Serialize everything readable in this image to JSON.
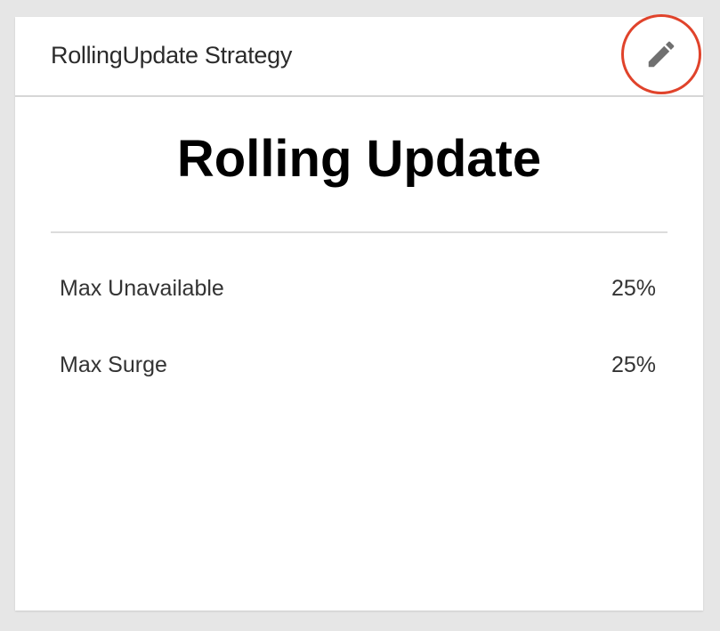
{
  "card": {
    "title": "RollingUpdate Strategy",
    "edit_icon": "pencil-icon",
    "heading": "Rolling Update",
    "rows": [
      {
        "label": "Max Unavailable",
        "value": "25%"
      },
      {
        "label": "Max Surge",
        "value": "25%"
      }
    ]
  },
  "colors": {
    "highlight_circle": "#e0432b",
    "icon": "#707070",
    "background": "#e6e6e6",
    "card": "#ffffff"
  }
}
